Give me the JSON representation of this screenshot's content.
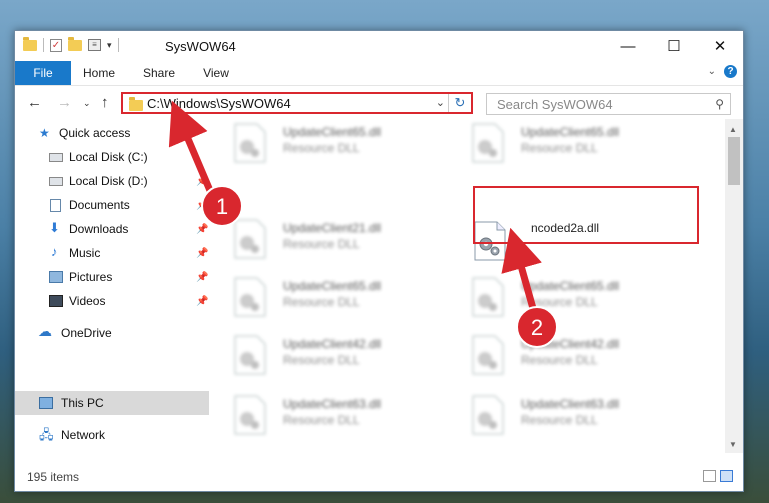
{
  "window": {
    "title": "SysWOW64",
    "controls": {
      "minimize": "—",
      "maximize": "☐",
      "close": "✕"
    }
  },
  "ribbon": {
    "tabs": [
      "File",
      "Home",
      "Share",
      "View"
    ],
    "help": "?"
  },
  "navigation": {
    "address": "C:\\Windows\\SysWOW64",
    "search_placeholder": "Search SysWOW64"
  },
  "sidebar": {
    "items": [
      {
        "label": "Quick access",
        "icon": "star-icon"
      },
      {
        "label": "Local Disk (C:)",
        "icon": "disk-icon",
        "pinned": true
      },
      {
        "label": "Local Disk (D:)",
        "icon": "disk-icon",
        "pinned": true
      },
      {
        "label": "Documents",
        "icon": "documents-icon",
        "pinned": true
      },
      {
        "label": "Downloads",
        "icon": "downloads-icon",
        "pinned": true
      },
      {
        "label": "Music",
        "icon": "music-icon",
        "pinned": true
      },
      {
        "label": "Pictures",
        "icon": "pictures-icon",
        "pinned": true
      },
      {
        "label": "Videos",
        "icon": "videos-icon",
        "pinned": true
      },
      {
        "label": "OneDrive",
        "icon": "onedrive-icon"
      },
      {
        "label": "This PC",
        "icon": "pc-icon",
        "selected": true
      },
      {
        "label": "Network",
        "icon": "network-icon"
      }
    ]
  },
  "files": [
    {
      "name": "UpdateClient65.dll",
      "type": "Resource DLL",
      "blurred": true
    },
    {
      "name": "UpdateClient65.dll",
      "type": "Resource DLL",
      "blurred": true
    },
    {
      "name": "UpdateClient21.dll",
      "type": "Resource DLL",
      "blurred": true
    },
    {
      "name": "ncoded2a.dll",
      "type": "",
      "blurred": false,
      "highlighted": true
    },
    {
      "name": "UpdateClient65.dll",
      "type": "Resource DLL",
      "blurred": true
    },
    {
      "name": "UpdateClient65.dll",
      "type": "Resource DLL",
      "blurred": true
    },
    {
      "name": "UpdateClient42.dll",
      "type": "Resource DLL",
      "blurred": true
    },
    {
      "name": "UpdateClient42.dll",
      "type": "Resource DLL",
      "blurred": true
    },
    {
      "name": "UpdateClient63.dll",
      "type": "Resource DLL",
      "blurred": true
    },
    {
      "name": "UpdateClient63.dll",
      "type": "Resource DLL",
      "blurred": true
    }
  ],
  "status": {
    "item_count": "195 items"
  },
  "annotations": {
    "step1": "1",
    "step2": "2",
    "color": "#d9272e"
  }
}
